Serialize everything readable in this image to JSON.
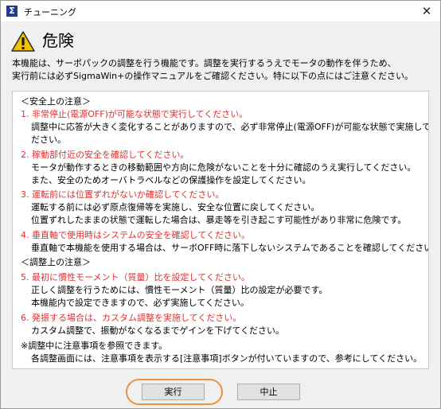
{
  "window": {
    "title": "チューニング",
    "app_icon": "Σ"
  },
  "dialog": {
    "heading": "危険",
    "intro": [
      "本機能は、サーボパックの調整を行う機能です。調整を実行するうえでモータの動作を伴うため、",
      "実行前には必ずSigmaWin+の操作マニュアルをご確認ください。特に以下の点にはご注意ください。"
    ]
  },
  "notes": [
    {
      "text": "＜安全上の注意＞",
      "color": "black"
    },
    {
      "text": "1. 非常停止(電源OFF)が可能な状態で実行してください。",
      "color": "red"
    },
    {
      "text": "調整中に応答が大きく変化することがありますので、必ず非常停止(電源OFF)が可能な状態で実施してく",
      "color": "black"
    },
    {
      "text": "ださい。",
      "color": "black"
    },
    {
      "text": "2. 稼動部付近の安全を確認してください。",
      "color": "red"
    },
    {
      "text": "モータが動作するときの移動範囲や方向に危険がないことを十分に確認のうえ実行してください。",
      "color": "black"
    },
    {
      "text": "また、安全のためオーバトラベルなどの保護操作を設定してください。",
      "color": "black"
    },
    {
      "text": "3. 運転前には位置ずれがないか確認してください。",
      "color": "red"
    },
    {
      "text": "運転する前には必ず原点復帰等を実施し、安全な位置に戻してください。",
      "color": "black"
    },
    {
      "text": "位置ずれしたままの状態で運転した場合は、暴走等を引き起こす可能性があり非常に危険です。",
      "color": "black"
    },
    {
      "text": "4. 垂直軸で使用時はシステムの安全を確認してください。",
      "color": "red"
    },
    {
      "text": "垂直軸で本機能を使用する場合は、サーボOFF時に落下しないシステムであることを確認してください。",
      "color": "black"
    },
    {
      "text": "＜調整上の注意＞",
      "color": "black"
    },
    {
      "text": "5. 最初に慣性モーメント（質量）比を設定してください。",
      "color": "red"
    },
    {
      "text": "正しく調整を行うためには、慣性モーメント（質量）比の設定が必要です。",
      "color": "black"
    },
    {
      "text": "本機能内で設定できますので、必ず実施してください。",
      "color": "black"
    },
    {
      "text": "6. 発振する場合は、カスタム調整を実施してください。",
      "color": "red"
    },
    {
      "text": "カスタム調整で、振動がなくなるまでゲインを下げてください。",
      "color": "black"
    },
    {
      "text": "※調整中に注意事項を参照できます。",
      "color": "black"
    },
    {
      "text": "各調整画面には、注意事項を表示する[注意事項]ボタンが付いていますので、参考にしてください。",
      "color": "black"
    }
  ],
  "buttons": {
    "execute": "実行",
    "stop": "中止"
  },
  "colors": {
    "warning_red": "#e03030",
    "highlight": "#e8923a",
    "warn_icon": "#f2c200"
  }
}
